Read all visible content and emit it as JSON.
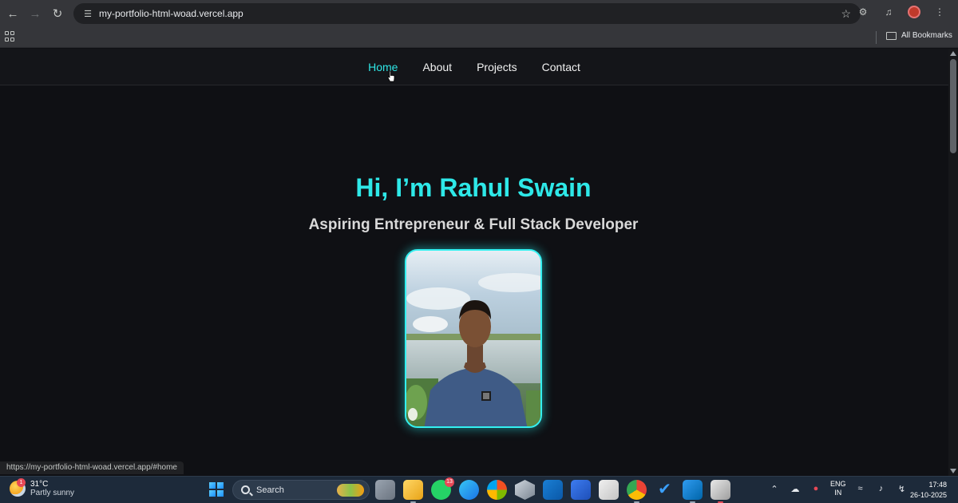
{
  "browser": {
    "url": "my-portfolio-html-woad.vercel.app",
    "bookmarks_label": "All Bookmarks",
    "status_url": "https://my-portfolio-html-woad.vercel.app/#home"
  },
  "site": {
    "nav": [
      {
        "label": "Home",
        "active": true
      },
      {
        "label": "About",
        "active": false
      },
      {
        "label": "Projects",
        "active": false
      },
      {
        "label": "Contact",
        "active": false
      }
    ],
    "hero_title": "Hi, I’m Rahul Swain",
    "hero_subtitle": "Aspiring Entrepreneur & Full Stack Developer",
    "accent_color": "#2ee8e8"
  },
  "taskbar": {
    "weather_badge": "1",
    "temperature": "31°C",
    "condition": "Partly sunny",
    "search_label": "Search",
    "whatsapp_badge": "13",
    "language": [
      "ENG",
      "IN"
    ],
    "time": "17:48",
    "date": "26-10-2025"
  }
}
